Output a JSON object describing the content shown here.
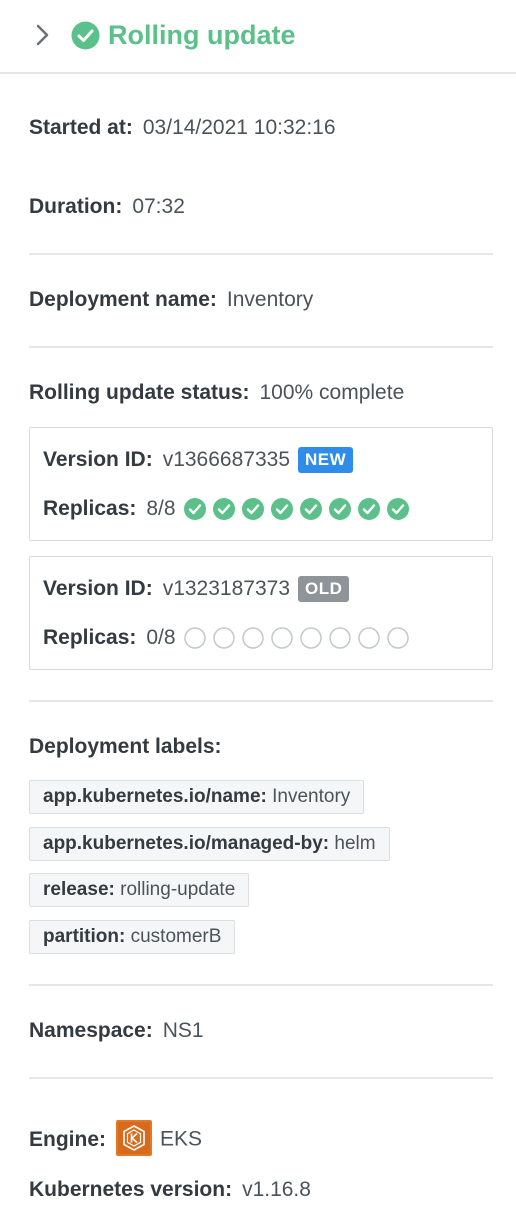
{
  "header": {
    "title": "Rolling update",
    "status": "success"
  },
  "started": {
    "label": "Started at:",
    "value": "03/14/2021 10:32:16"
  },
  "duration": {
    "label": "Duration:",
    "value": "07:32"
  },
  "deployment": {
    "label": "Deployment name:",
    "value": "Inventory"
  },
  "rolling_status": {
    "label": "Rolling update status:",
    "value": "100% complete"
  },
  "versions": [
    {
      "id_label": "Version ID:",
      "id": "v1366687335",
      "badge": "NEW",
      "replicas_label": "Replicas:",
      "replicas": "8/8",
      "ready": 8,
      "total": 8
    },
    {
      "id_label": "Version ID:",
      "id": "v1323187373",
      "badge": "OLD",
      "replicas_label": "Replicas:",
      "replicas": "0/8",
      "ready": 0,
      "total": 8
    }
  ],
  "labels": {
    "title": "Deployment labels:",
    "items": [
      {
        "key": "app.kubernetes.io/name:",
        "value": "Inventory"
      },
      {
        "key": "app.kubernetes.io/managed-by:",
        "value": "helm"
      },
      {
        "key": "release:",
        "value": "rolling-update"
      },
      {
        "key": "partition:",
        "value": "customerB"
      }
    ]
  },
  "namespace": {
    "label": "Namespace:",
    "value": "NS1"
  },
  "engine": {
    "label": "Engine:",
    "value": "EKS",
    "icon": "eks-logo-icon"
  },
  "k8s": {
    "label": "Kubernetes version:",
    "value": "v1.16.8"
  },
  "colors": {
    "success": "#5cc08a",
    "new": "#2f8ce8",
    "old": "#8f9499",
    "empty_dot": "#c4c8cc",
    "eks": "#e07a26"
  }
}
